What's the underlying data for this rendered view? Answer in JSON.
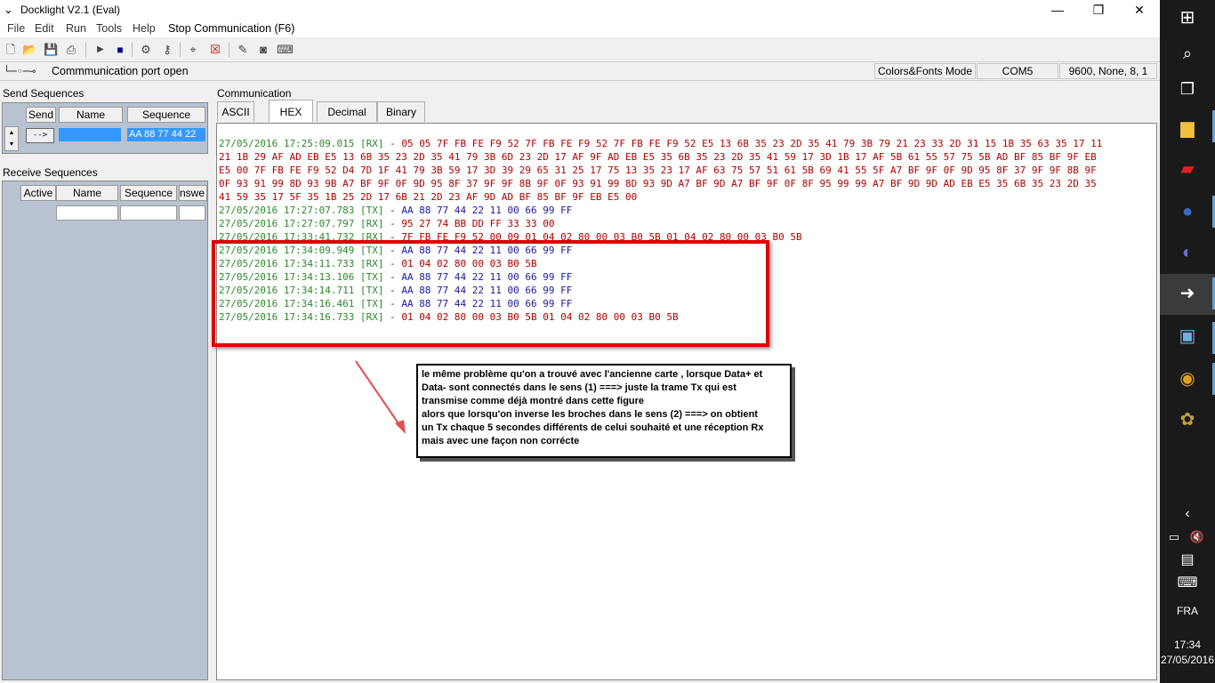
{
  "window": {
    "title": "Docklight V2.1 (Eval)",
    "minimize": "—",
    "maximize": "❐",
    "close": "✕"
  },
  "menu": {
    "items": [
      "File",
      "Edit",
      "Run",
      "Tools",
      "Help",
      "Stop Communication  (F6)"
    ]
  },
  "status": {
    "port_text": "Commmunication port open",
    "mode": "Colors&Fonts Mode",
    "port": "COM5",
    "settings": "9600, None, 8, 1"
  },
  "send_sequences": {
    "label": "Send Sequences",
    "columns": [
      "Send",
      "Name",
      "Sequence"
    ],
    "rows": [
      {
        "send": "-->",
        "name": "",
        "sequence": "AA 88 77 44 22"
      }
    ]
  },
  "receive_sequences": {
    "label": "Receive Sequences",
    "columns": [
      "Active",
      "Name",
      "Sequence",
      "Answer"
    ],
    "answer_visible": "nswe"
  },
  "communication": {
    "label": "Communication",
    "tabs": [
      "ASCII",
      "HEX",
      "Decimal",
      "Binary"
    ],
    "active_tab": "HEX",
    "lines": [
      {
        "ts": "27/05/2016 17:25:09.015",
        "dir": "[RX]",
        "data": " - 05 05 7F FB FE F9 52 7F FB FE F9 52 7F FB FE F9 52 E5 13 6B 35 23 2D 35 41 79 3B 79 21 23 33 2D 31 15 1B 35 63 35 17 11"
      },
      {
        "ts": "",
        "dir": "",
        "data": "21 1B 29 AF AD EB E5 13 6B 35 23 2D 35 41 79 3B 6D 23 2D 17 AF 9F AD EB E5 35 6B 35 23 2D 35 41 59 17 3D 1B 17 AF 5B 61 55 57 75 5B AD BF 85 BF 9F EB"
      },
      {
        "ts": "",
        "dir": "",
        "data": "E5 00 7F FB FE F9 52 D4 7D 1F 41 79 3B 59 17 3D 39 29 65 31 25 17 75 13 35 23 17 AF 63 75 57 51 61 5B 69 41 55 5F A7 BF 9F 0F 9D 95 8F 37 9F 9F 8B 9F"
      },
      {
        "ts": "",
        "dir": "",
        "data": "0F 93 91 99 8D 93 9B A7 BF 9F 0F 9D 95 8F 37 9F 9F 8B 9F 0F 93 91 99 8D 93 9D A7 BF 9D A7 BF 9F 0F 8F 95 99 99 A7 BF 9D 9D AD EB E5 35 6B 35 23 2D 35"
      },
      {
        "ts": "",
        "dir": "",
        "data": "41 59 35 17 5F 35 1B 25 2D 17 6B 21 2D 23 AF 9D AD BF 85 BF 9F EB E5 00"
      },
      {
        "ts": "27/05/2016 17:27:07.783",
        "dir": "[TX]",
        "data": " - AA 88 77 44 22 11 00 66 99 FF"
      },
      {
        "ts": "27/05/2016 17:27:07.797",
        "dir": "[RX]",
        "data": " - 95 27 74 BB DD FF 33 33 00"
      },
      {
        "ts": "27/05/2016 17:33:41.732",
        "dir": "[RX]",
        "data": " - 7F FB FE F9 52 00 09 01 04 02 80 00 03 B0 5B 01 04 02 80 00 03 B0 5B"
      },
      {
        "ts": "27/05/2016 17:34:09.949",
        "dir": "[TX]",
        "data": " - AA 88 77 44 22 11 00 66 99 FF"
      },
      {
        "ts": "27/05/2016 17:34:11.733",
        "dir": "[RX]",
        "data": " - 01 04 02 80 00 03 B0 5B"
      },
      {
        "ts": "27/05/2016 17:34:13.106",
        "dir": "[TX]",
        "data": " - AA 88 77 44 22 11 00 66 99 FF"
      },
      {
        "ts": "27/05/2016 17:34:14.711",
        "dir": "[TX]",
        "data": " - AA 88 77 44 22 11 00 66 99 FF"
      },
      {
        "ts": "27/05/2016 17:34:16.461",
        "dir": "[TX]",
        "data": " - AA 88 77 44 22 11 00 66 99 FF"
      },
      {
        "ts": "27/05/2016 17:34:16.733",
        "dir": "[RX]",
        "data": " - 01 04 02 80 00 03 B0 5B 01 04 02 80 00 03 B0 5B"
      }
    ]
  },
  "annotation": {
    "text": "le même problème qu'on a trouvé avec l'ancienne carte , lorsque Data+ et\nData- sont connectés dans le sens (1) ===> juste la trame Tx qui est\ntransmise comme déjà montré dans cette figure\nalors que lorsqu'on inverse les broches dans le sens (2) ===> on obtient\nun Tx chaque 5 secondes différents de celui souhaité et une réception Rx\nmais avec une façon non corrécte"
  },
  "taskbar": {
    "language": "FRA",
    "time": "17:34",
    "date": "27/05/2016"
  },
  "colors": {
    "timestamp": "#2a8a2a",
    "rx": "#b00000",
    "tx": "#1a1aa0",
    "highlight": "#dd0000"
  }
}
